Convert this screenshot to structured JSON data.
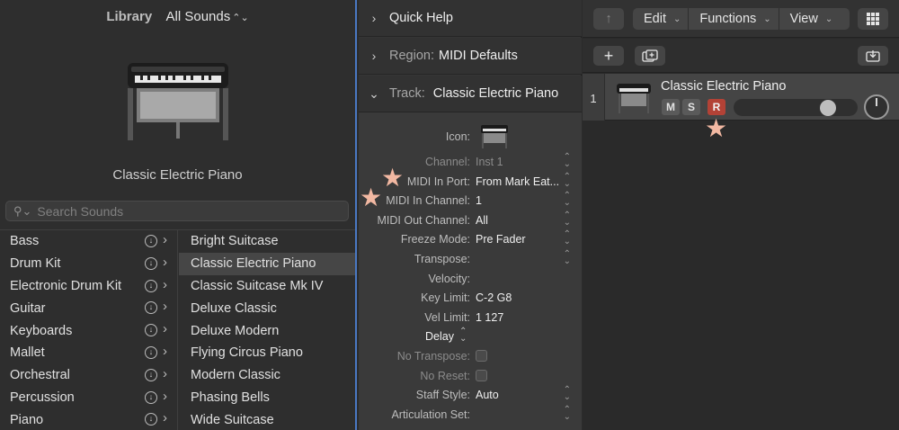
{
  "library": {
    "label": "Library",
    "filter_value": "All Sounds",
    "preset_name": "Classic Electric Piano",
    "search_placeholder": "Search Sounds",
    "categories": [
      "Bass",
      "Drum Kit",
      "Electronic Drum Kit",
      "Guitar",
      "Keyboards",
      "Mallet",
      "Orchestral",
      "Percussion",
      "Piano"
    ],
    "presets": [
      "Bright Suitcase",
      "Classic Electric Piano",
      "Classic Suitcase Mk IV",
      "Deluxe Classic",
      "Deluxe Modern",
      "Flying Circus Piano",
      "Modern Classic",
      "Phasing Bells",
      "Wide Suitcase"
    ],
    "selected_preset_index": 1
  },
  "inspector": {
    "quick_help": "Quick Help",
    "region_label": "Region:",
    "region_value": "MIDI Defaults",
    "track_label": "Track:",
    "track_value": "Classic Electric Piano",
    "icon_label": "Icon:",
    "params": [
      {
        "label": "Channel:",
        "value": "Inst 1"
      },
      {
        "label": "MIDI In Port:",
        "value": "From Mark Eat..."
      },
      {
        "label": "MIDI In Channel:",
        "value": "1"
      },
      {
        "label": "MIDI Out Channel:",
        "value": "All"
      },
      {
        "label": "Freeze Mode:",
        "value": "Pre Fader"
      },
      {
        "label": "Transpose:",
        "value": ""
      },
      {
        "label": "Velocity:",
        "value": ""
      },
      {
        "label": "Key Limit:",
        "value": "C-2  G8"
      },
      {
        "label": "Vel Limit:",
        "value": "1  127"
      },
      {
        "label": "Delay",
        "value": ""
      },
      {
        "label": "No Transpose:",
        "value": ""
      },
      {
        "label": "No Reset:",
        "value": ""
      },
      {
        "label": "Staff Style:",
        "value": "Auto"
      },
      {
        "label": "Articulation Set:",
        "value": ""
      }
    ]
  },
  "toolbar": {
    "up_arrow": "↑",
    "edit": "Edit",
    "functions": "Functions",
    "view": "View",
    "add": "+"
  },
  "track": {
    "number": "1",
    "name": "Classic Electric Piano",
    "mute": "M",
    "solo": "S",
    "record": "R",
    "volume": 0.8
  },
  "colors": {
    "record": "#b34236",
    "selection_outline": "#4a78c2",
    "annotation_star": "#f2b8a2"
  }
}
